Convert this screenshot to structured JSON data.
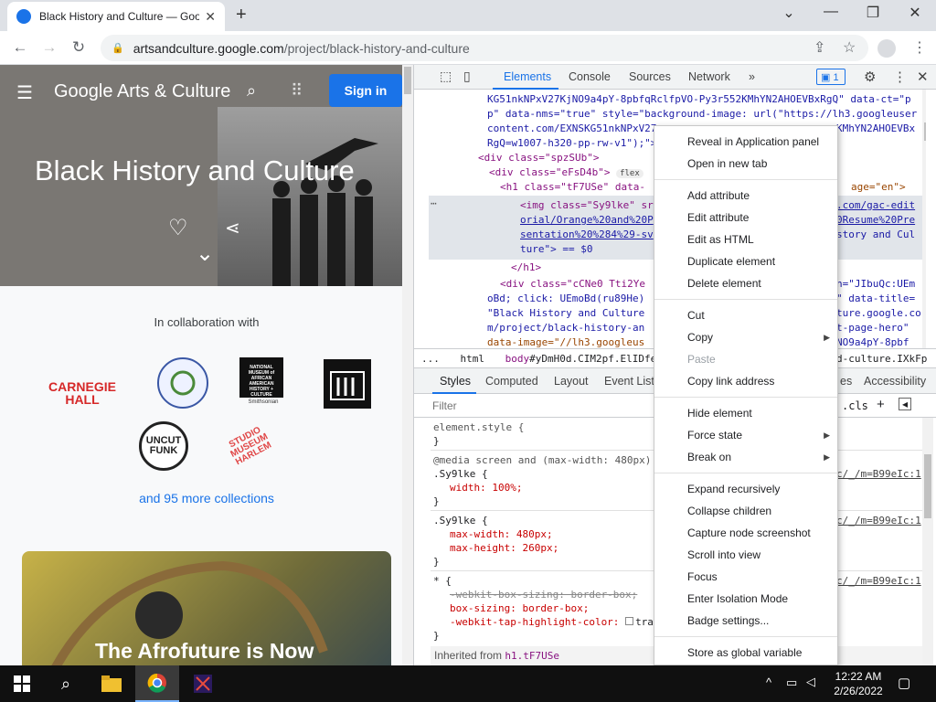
{
  "browser": {
    "tab_title": "Black History and Culture — Goo",
    "url_domain": "artsandculture.google.com",
    "url_path": "/project/black-history-and-culture"
  },
  "page": {
    "menu_icon": "hamburger-icon",
    "brand": "Google Arts & Culture",
    "sign_in": "Sign in",
    "hero_title": "Black History and Culture",
    "collab_text": "In collaboration with",
    "logos": [
      "CARNEGIE HALL",
      "NATIONAL MUSEUM of AFRICAN AMERICAN HISTORY + CULTURE",
      "UNCUT FUNK",
      "STUDIO MUSEUM HARLEM"
    ],
    "logo_subtext": "Smithsonian",
    "more_link": "and 95 more collections",
    "card_title": "The Afrofuture is Now"
  },
  "devtools": {
    "tabs": [
      "Elements",
      "Console",
      "Sources",
      "Network"
    ],
    "issues_count": "1",
    "breadcrumb": {
      "a": "...",
      "b": "html",
      "c": "body",
      "d": "#yDmH0d.CIM2pf.ElIDfe",
      "e": "d-culture.IXkFp"
    },
    "style_tabs": [
      "Styles",
      "Computed",
      "Layout",
      "Event Liste",
      "es",
      "Accessibility"
    ],
    "filter_placeholder": "Filter",
    "cls": ".cls",
    "dom_lines": {
      "l1": "KG51nkNPxV27KjNO9a4pY-8pbfqRclfpVO-Py3r552KMhYN2AHOEVBxRgQ\" data-ct=\"p",
      "l2": "p\" data-nms=\"true\" style=\"background-image: url(\"https://lh3.googleuser",
      "l3": "content.com/EXNSKG51nkNPxV27",
      "l3b": "KMhYN2AHOEVBx",
      "l4": "RgQ=w1007-h320-pp-rw-v1\");\">",
      "l5": "<div class=\"spzSUb\">",
      "l6": "<div class=\"eFsD4b\">",
      "l6b": "flex",
      "l7": "<h1 class=\"tF7USe\" data-",
      "l7b": "age=\"en\">",
      "l8": "<img class=\"Sy9lke\" sr",
      "l8b": ".com/gac-edit",
      "l9": "orial/Orange%20and%20P",
      "l9b": "0Resume%20Pre",
      "l10": "sentation%20%284%29-sv",
      "l10b": "story and Cul",
      "l11": "ture\"> == $0",
      "l12": "</h1>",
      "l13": "<div class=\"cCNe0 Tti2Ye",
      "l13b": "n=\"JIbuQc:UEm",
      "l14": "oBd; click: UEmoBd(ru89He)",
      "l14b": "\" data-title=",
      "l15": "\"Black History and Culture",
      "l15b": "ture.google.co",
      "l16": "m/project/black-history-an",
      "l16b": "t-page-hero\"",
      "l17": "data-image=\"//lh3.googleus",
      "l17b": "NO9a4pY-8pbf"
    },
    "styles_lines": {
      "s1": "element.style {",
      "s2": "}",
      "s3": "@media screen and (max-width: 480px)",
      "s4": ".Sy9lke {",
      "s5": "width: 100%;",
      "s6": "}",
      "s7": ".Sy9lke {",
      "s8": "max-width: 480px;",
      "s9": "max-height: 260px;",
      "s10": "}",
      "s11": "* {",
      "s12": "-webkit-box-sizing: border-box;",
      "s13": "box-sizing: border-box;",
      "s14": "-webkit-tap-highlight-color: ",
      "s14b": "tra",
      "s15": "}",
      "inherited": "Inherited from",
      "inherited_el": "h1.tF7USe",
      "src1": "c/_/m=B99eIc:1",
      "src2": "c/_/m=B99eIc:1",
      "src3": "c/_/m=B99eIc:1",
      "src4": "c/_/m=B99eIc:1"
    }
  },
  "context_menu": {
    "items": [
      "Reveal in Application panel",
      "Open in new tab",
      "Add attribute",
      "Edit attribute",
      "Edit as HTML",
      "Duplicate element",
      "Delete element",
      "Cut",
      "Copy",
      "Paste",
      "Copy link address",
      "Hide element",
      "Force state",
      "Break on",
      "Expand recursively",
      "Collapse children",
      "Capture node screenshot",
      "Scroll into view",
      "Focus",
      "Enter Isolation Mode",
      "Badge settings...",
      "Store as global variable"
    ]
  },
  "taskbar": {
    "time": "12:22 AM",
    "date": "2/26/2022"
  },
  "colors": {
    "accent": "#1a73e8",
    "carnegie": "#d62828",
    "studio": "#e04545"
  }
}
